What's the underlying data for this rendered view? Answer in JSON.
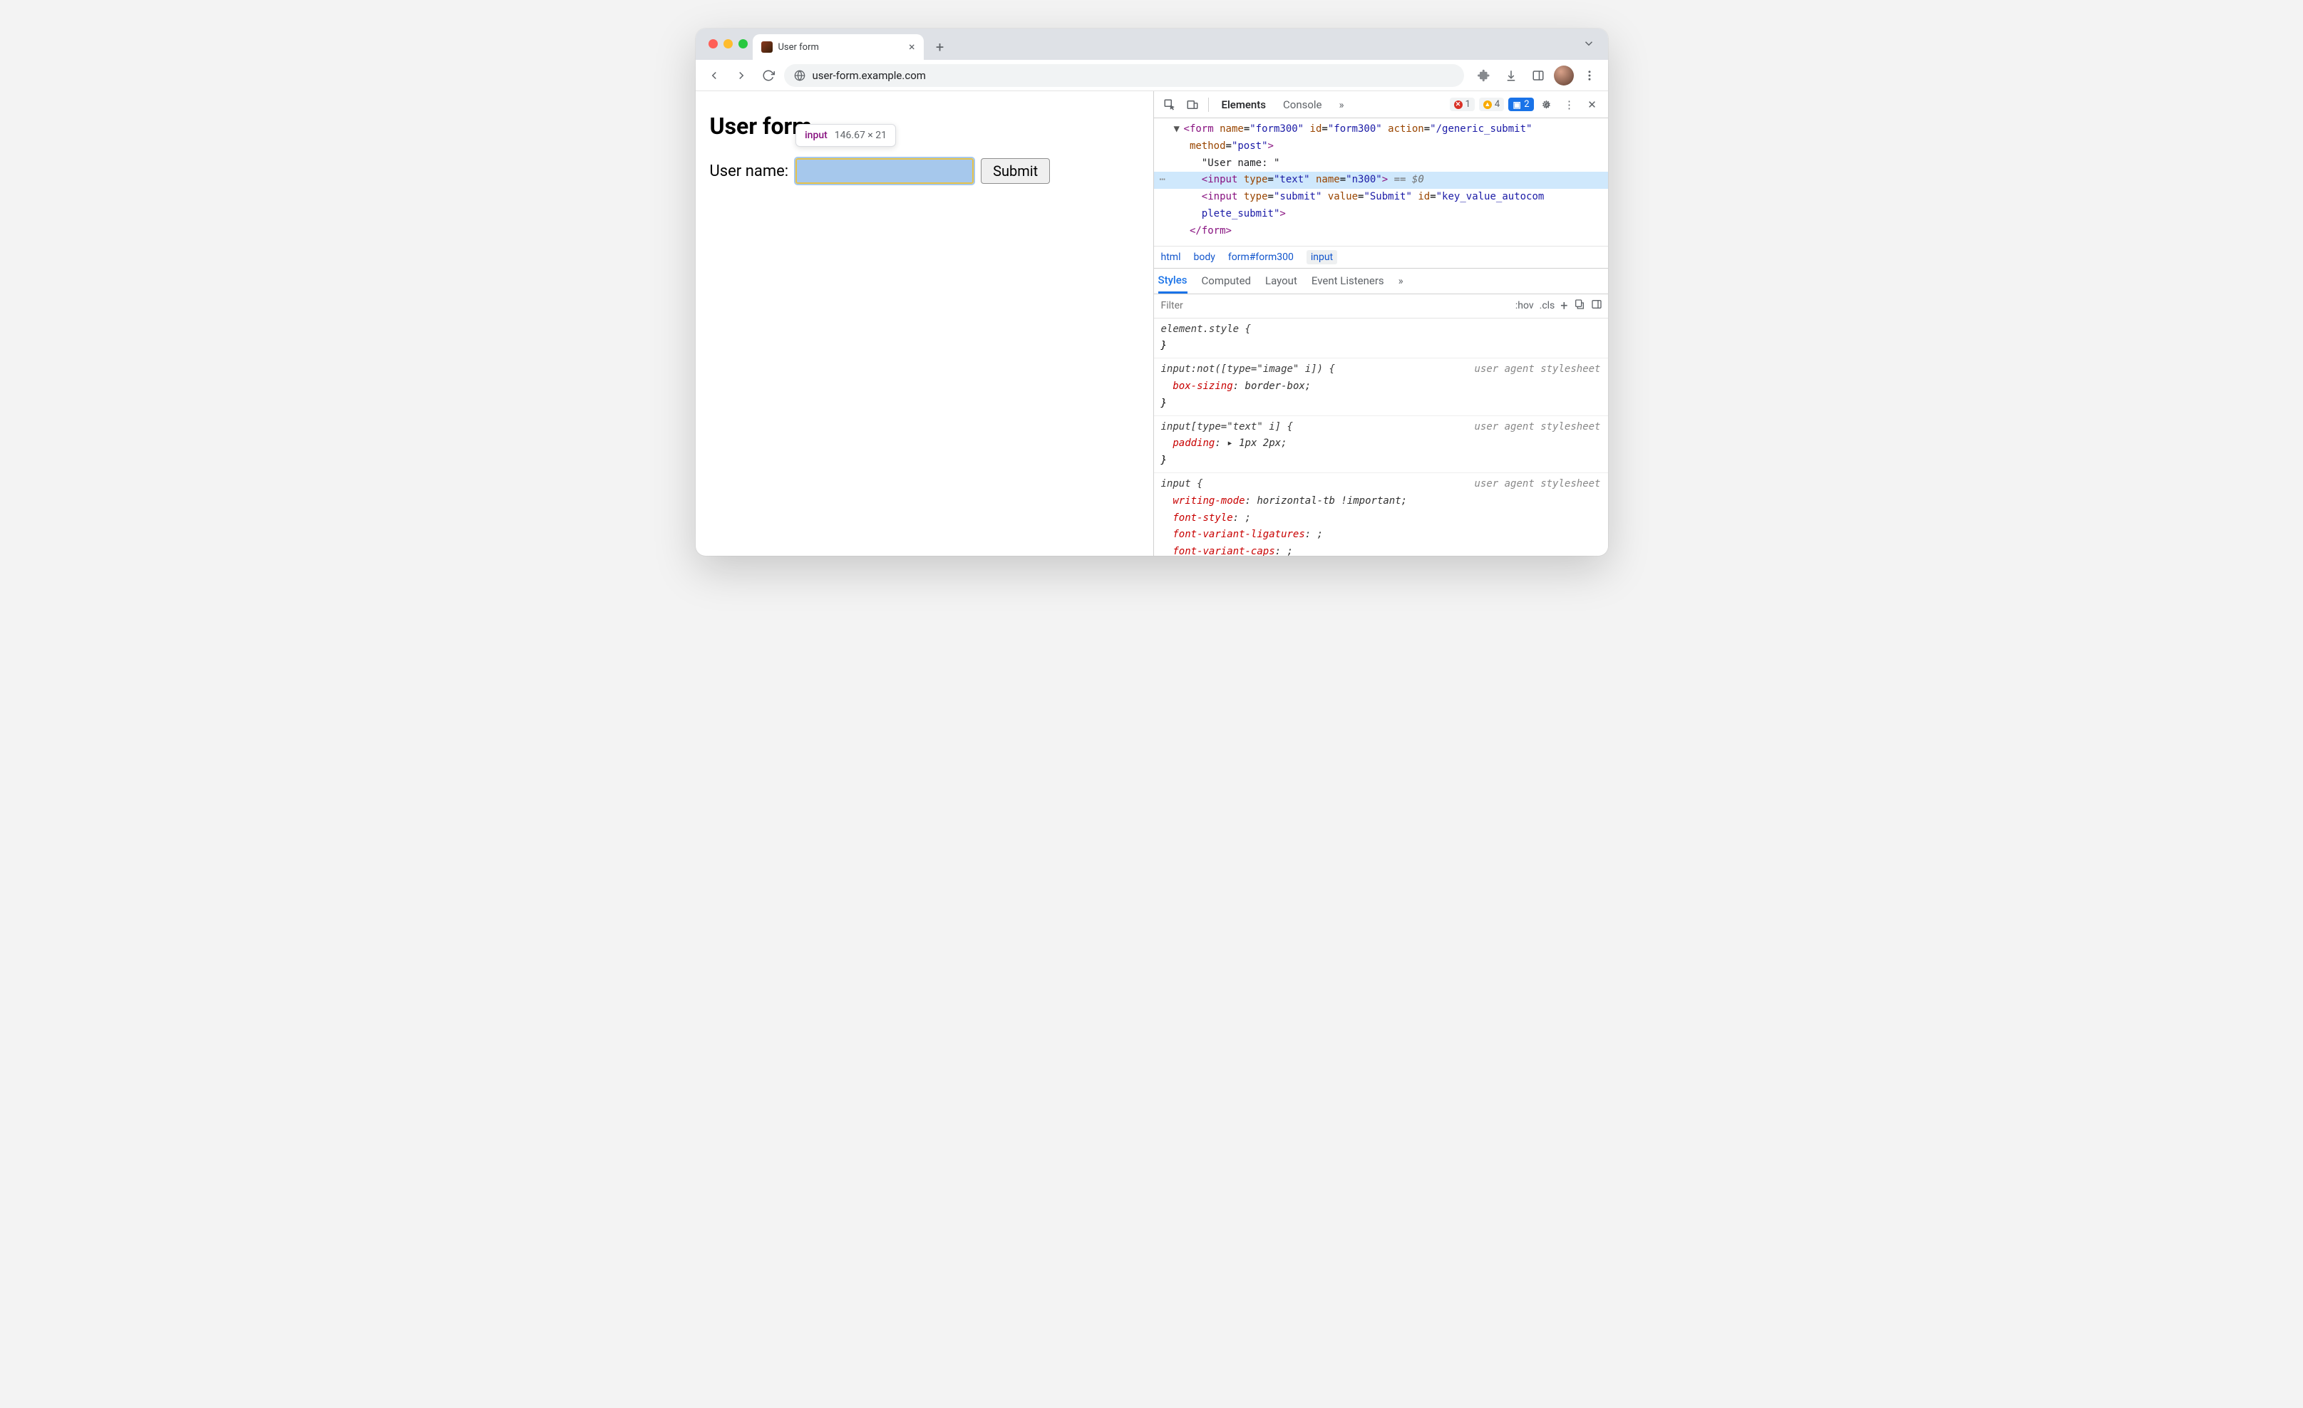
{
  "browser": {
    "tab_title": "User form",
    "url": "user-form.example.com",
    "errors": "1",
    "warnings": "4",
    "issues": "2"
  },
  "page": {
    "heading": "User form",
    "label": "User name:",
    "submit": "Submit",
    "tooltip_tag": "input",
    "tooltip_dims": "146.67 × 21"
  },
  "devtools": {
    "tabs": {
      "elements": "Elements",
      "console": "Console"
    },
    "dom": {
      "form_open_1": "<form name=\"form300\" id=\"form300\" action=\"/generic_submit\"",
      "form_open_2": "method=\"post\">",
      "text_node": "\"User name: \"",
      "input_text": "<input type=\"text\" name=\"n300\">",
      "eq_zero": " == $0",
      "input_submit_1": "<input type=\"submit\" value=\"Submit\" id=\"key_value_autocom",
      "input_submit_2": "plete_submit\">",
      "form_close": "</form>"
    },
    "breadcrumb": [
      "html",
      "body",
      "form#form300",
      "input"
    ],
    "styles_tabs": {
      "styles": "Styles",
      "computed": "Computed",
      "layout": "Layout",
      "event": "Event Listeners"
    },
    "filter_placeholder": "Filter",
    "hov": ":hov",
    "cls": ".cls",
    "rules": {
      "el_style_sel": "element.style {",
      "close": "}",
      "ua": "user agent stylesheet",
      "r1_sel": "input:not([type=\"image\" i]) {",
      "r1_p1": "box-sizing",
      "r1_v1": ": border-box;",
      "r2_sel": "input[type=\"text\" i] {",
      "r2_p1": "padding",
      "r2_v1": ": ▸ 1px 2px;",
      "r3_sel": "input {",
      "r3_p1": "writing-mode",
      "r3_v1": ": horizontal-tb !important;",
      "r3_p2": "font-style",
      "r3_v2": ": ;",
      "r3_p3": "font-variant-ligatures",
      "r3_v3": ": ;",
      "r3_p4": "font-variant-caps",
      "r3_v4": ": ;"
    }
  }
}
